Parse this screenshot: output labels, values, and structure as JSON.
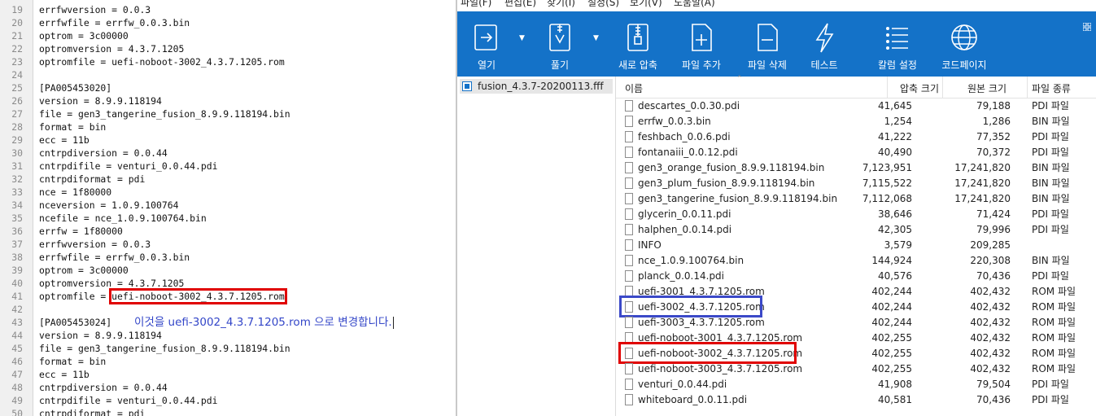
{
  "editor": {
    "lines": [
      {
        "n": "19",
        "text": "errfwversion = 0.0.3"
      },
      {
        "n": "20",
        "text": "errfwfile = errfw_0.0.3.bin"
      },
      {
        "n": "21",
        "text": "optrom = 3c00000"
      },
      {
        "n": "22",
        "text": "optromversion = 4.3.7.1205"
      },
      {
        "n": "23",
        "text": "optromfile = uefi-noboot-3002_4.3.7.1205.rom"
      },
      {
        "n": "24",
        "text": ""
      },
      {
        "n": "25",
        "text": "[PA005453020]"
      },
      {
        "n": "26",
        "text": "version = 8.9.9.118194"
      },
      {
        "n": "27",
        "text": "file = gen3_tangerine_fusion_8.9.9.118194.bin"
      },
      {
        "n": "28",
        "text": "format = bin"
      },
      {
        "n": "29",
        "text": "ecc = 11b"
      },
      {
        "n": "30",
        "text": "cntrpdiversion = 0.0.44"
      },
      {
        "n": "31",
        "text": "cntrpdifile = venturi_0.0.44.pdi"
      },
      {
        "n": "32",
        "text": "cntrpdiformat = pdi"
      },
      {
        "n": "33",
        "text": "nce = 1f80000"
      },
      {
        "n": "34",
        "text": "nceversion = 1.0.9.100764"
      },
      {
        "n": "35",
        "text": "ncefile = nce_1.0.9.100764.bin"
      },
      {
        "n": "36",
        "text": "errfw = 1f80000"
      },
      {
        "n": "37",
        "text": "errfwversion = 0.0.3"
      },
      {
        "n": "38",
        "text": "errfwfile = errfw_0.0.3.bin"
      },
      {
        "n": "39",
        "text": "optrom = 3c00000"
      },
      {
        "n": "40",
        "text": "optromversion = 4.3.7.1205"
      },
      {
        "n": "41",
        "text": "optromfile = ",
        "highlight": "uefi-noboot-3002_4.3.7.1205.rom"
      },
      {
        "n": "42",
        "text": ""
      },
      {
        "n": "43",
        "text": "[PA005453024]"
      },
      {
        "n": "44",
        "text": "version = 8.9.9.118194"
      },
      {
        "n": "45",
        "text": "file = gen3_tangerine_fusion_8.9.9.118194.bin"
      },
      {
        "n": "46",
        "text": "format = bin"
      },
      {
        "n": "47",
        "text": "ecc = 11b"
      },
      {
        "n": "48",
        "text": "cntrpdiversion = 0.0.44"
      },
      {
        "n": "49",
        "text": "cntrpdifile = venturi_0.0.44.pdi"
      },
      {
        "n": "50",
        "text": "cntrpdiformat = pdi"
      }
    ],
    "annotation": "이것을 uefi-3002_4.3.7.1205.rom 으로 변경합니다."
  },
  "archive": {
    "menu": [
      "파일(F)",
      "편집(E)",
      "찾기(I)",
      "설정(S)",
      "보기(V)",
      "도움말(A)"
    ],
    "toolbar": [
      {
        "label": "열기",
        "icon": "open-icon"
      },
      {
        "label": "풀기",
        "icon": "extract-icon"
      },
      {
        "label": "새로 압축",
        "icon": "new-archive-icon"
      },
      {
        "label": "파일 추가",
        "icon": "add-file-icon"
      },
      {
        "label": "파일 삭제",
        "icon": "delete-file-icon"
      },
      {
        "label": "테스트",
        "icon": "test-icon"
      },
      {
        "label": "칼럼 설정",
        "icon": "columns-icon"
      },
      {
        "label": "코드페이지",
        "icon": "codepage-icon"
      }
    ],
    "tree_item": "fusion_4.3.7-20200113.fff",
    "columns": {
      "name": "이름",
      "compressed": "압축 크기",
      "original": "원본 크기",
      "type": "파일 종류"
    },
    "files": [
      {
        "name": "descartes_0.0.30.pdi",
        "compressed": "41,645",
        "original": "79,188",
        "type": "PDI 파일"
      },
      {
        "name": "errfw_0.0.3.bin",
        "compressed": "1,254",
        "original": "1,286",
        "type": "BIN 파일"
      },
      {
        "name": "feshbach_0.0.6.pdi",
        "compressed": "41,222",
        "original": "77,352",
        "type": "PDI 파일"
      },
      {
        "name": "fontanaiii_0.0.12.pdi",
        "compressed": "40,490",
        "original": "70,372",
        "type": "PDI 파일"
      },
      {
        "name": "gen3_orange_fusion_8.9.9.118194.bin",
        "compressed": "7,123,951",
        "original": "17,241,820",
        "type": "BIN 파일"
      },
      {
        "name": "gen3_plum_fusion_8.9.9.118194.bin",
        "compressed": "7,115,522",
        "original": "17,241,820",
        "type": "BIN 파일"
      },
      {
        "name": "gen3_tangerine_fusion_8.9.9.118194.bin",
        "compressed": "7,112,068",
        "original": "17,241,820",
        "type": "BIN 파일"
      },
      {
        "name": "glycerin_0.0.11.pdi",
        "compressed": "38,646",
        "original": "71,424",
        "type": "PDI 파일"
      },
      {
        "name": "halphen_0.0.14.pdi",
        "compressed": "42,305",
        "original": "79,996",
        "type": "PDI 파일"
      },
      {
        "name": "INFO",
        "compressed": "3,579",
        "original": "209,285",
        "type": ""
      },
      {
        "name": "nce_1.0.9.100764.bin",
        "compressed": "144,924",
        "original": "220,308",
        "type": "BIN 파일"
      },
      {
        "name": "planck_0.0.14.pdi",
        "compressed": "40,576",
        "original": "70,436",
        "type": "PDI 파일"
      },
      {
        "name": "uefi-3001_4.3.7.1205.rom",
        "compressed": "402,244",
        "original": "402,432",
        "type": "ROM 파일"
      },
      {
        "name": "uefi-3002_4.3.7.1205.rom",
        "compressed": "402,244",
        "original": "402,432",
        "type": "ROM 파일",
        "mark": "blue"
      },
      {
        "name": "uefi-3003_4.3.7.1205.rom",
        "compressed": "402,244",
        "original": "402,432",
        "type": "ROM 파일"
      },
      {
        "name": "uefi-noboot-3001_4.3.7.1205.rom",
        "compressed": "402,255",
        "original": "402,432",
        "type": "ROM 파일"
      },
      {
        "name": "uefi-noboot-3002_4.3.7.1205.rom",
        "compressed": "402,255",
        "original": "402,432",
        "type": "ROM 파일",
        "mark": "red"
      },
      {
        "name": "uefi-noboot-3003_4.3.7.1205.rom",
        "compressed": "402,255",
        "original": "402,432",
        "type": "ROM 파일"
      },
      {
        "name": "venturi_0.0.44.pdi",
        "compressed": "41,908",
        "original": "79,504",
        "type": "PDI 파일"
      },
      {
        "name": "whiteboard_0.0.11.pdi",
        "compressed": "40,581",
        "original": "70,436",
        "type": "PDI 파일"
      }
    ],
    "colors": {
      "toolbar": "#1472c8",
      "highlight_red": "#e00000",
      "highlight_blue": "#3b49c8"
    }
  }
}
